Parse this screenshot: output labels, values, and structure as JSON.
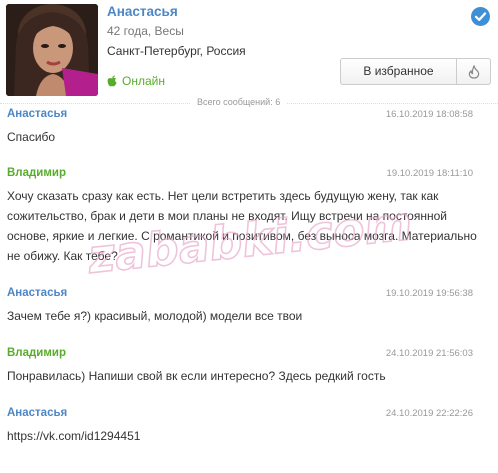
{
  "profile": {
    "name": "Анастасья",
    "age_line": "42 года, Весы",
    "location": "Санкт-Петербург, Россия",
    "status": "Онлайн",
    "status_color": "#58ac2c",
    "verified_icon": "check-circle-icon",
    "favorite_label": "В избранное",
    "hot_icon": "fire-icon"
  },
  "thread": {
    "total_label": "Всего сообщений: 6"
  },
  "messages": [
    {
      "author": "Анастасья",
      "date": "16.10.2019 18:08:58",
      "text": "Спасибо"
    },
    {
      "author": "Владимир",
      "date": "19.10.2019 18:11:10",
      "text": "Хочу сказать сразу как есть. Нет цели встретить здесь будущую жену, так как сожительство, брак и дети в мои планы не входят. Ищу встречи на постоянной основе, яркие и легкие. С романтикой и позитивом, без выноса мозга. Материально не обижу. Как тебе?"
    },
    {
      "author": "Анастасья",
      "date": "19.10.2019 19:56:38",
      "text": "Зачем тебе я?) красивый, молодой) модели все твои"
    },
    {
      "author": "Владимир",
      "date": "24.10.2019 21:56:03",
      "text": "Понравилась) Напиши свой вк если интересно? Здесь редкий гость"
    },
    {
      "author": "Анастасья",
      "date": "24.10.2019 22:22:26",
      "text": "https://vk.com/id1294451"
    }
  ],
  "watermark": "zababki.com",
  "colors": {
    "female_name": "#4d86c6",
    "male_name": "#58ac2c",
    "date": "#999999",
    "verified": "#3f8fd6"
  }
}
